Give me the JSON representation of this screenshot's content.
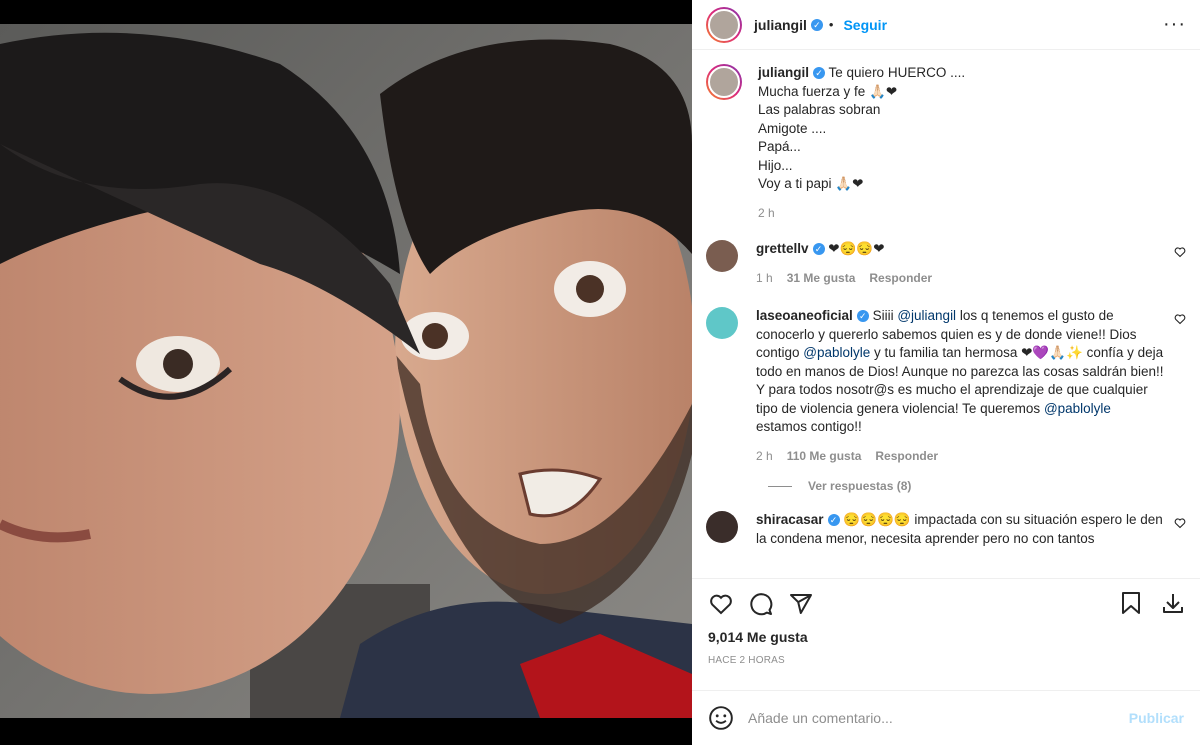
{
  "header": {
    "username": "juliangil",
    "separator": "•",
    "follow_label": "Seguir",
    "more_label": "···"
  },
  "caption": {
    "username": "juliangil",
    "lines": [
      "Te quiero HUERCO ....",
      "Mucha fuerza y fe 🙏🏻❤",
      "Las palabras sobran",
      "Amigote ....",
      "Papá...",
      "Hijo...",
      "Voy a ti papi 🙏🏻❤"
    ],
    "time": "2 h"
  },
  "comments": [
    {
      "username": "grettellv",
      "text": "❤😔😔❤",
      "time": "1 h",
      "likes": "31 Me gusta",
      "reply": "Responder"
    },
    {
      "username": "laseoaneoficial",
      "text_parts": [
        "Siiii ",
        "@juliangil",
        " los q tenemos el gusto de conocerlo y quererlo sabemos quien es y de donde viene!! Dios contigo ",
        "@pablolyle",
        " y tu familia tan hermosa ❤💜🙏🏻✨ confía y deja todo en manos de Dios! Aunque no parezca las cosas saldrán bien!! Y para todos nosotr@s es mucho el aprendizaje de que cualquier tipo de violencia genera violencia! Te queremos ",
        "@pablolyle",
        " estamos contigo!!"
      ],
      "time": "2 h",
      "likes": "110 Me gusta",
      "reply": "Responder",
      "view_replies": "Ver respuestas (8)"
    },
    {
      "username": "shiracasar",
      "text": "😔😔😔😔 impactada con su situación espero le den la condena menor, necesita aprender pero no con tantos"
    }
  ],
  "likes_count": "9,014 Me gusta",
  "posted_ago": "HACE 2 HORAS",
  "add_comment": {
    "placeholder": "Añade un comentario...",
    "publish_label": "Publicar"
  },
  "colors": {
    "link": "#0095f6",
    "verified": "#3897f0",
    "muted": "#8e8e8e",
    "publish_disabled": "#b2dffc"
  }
}
